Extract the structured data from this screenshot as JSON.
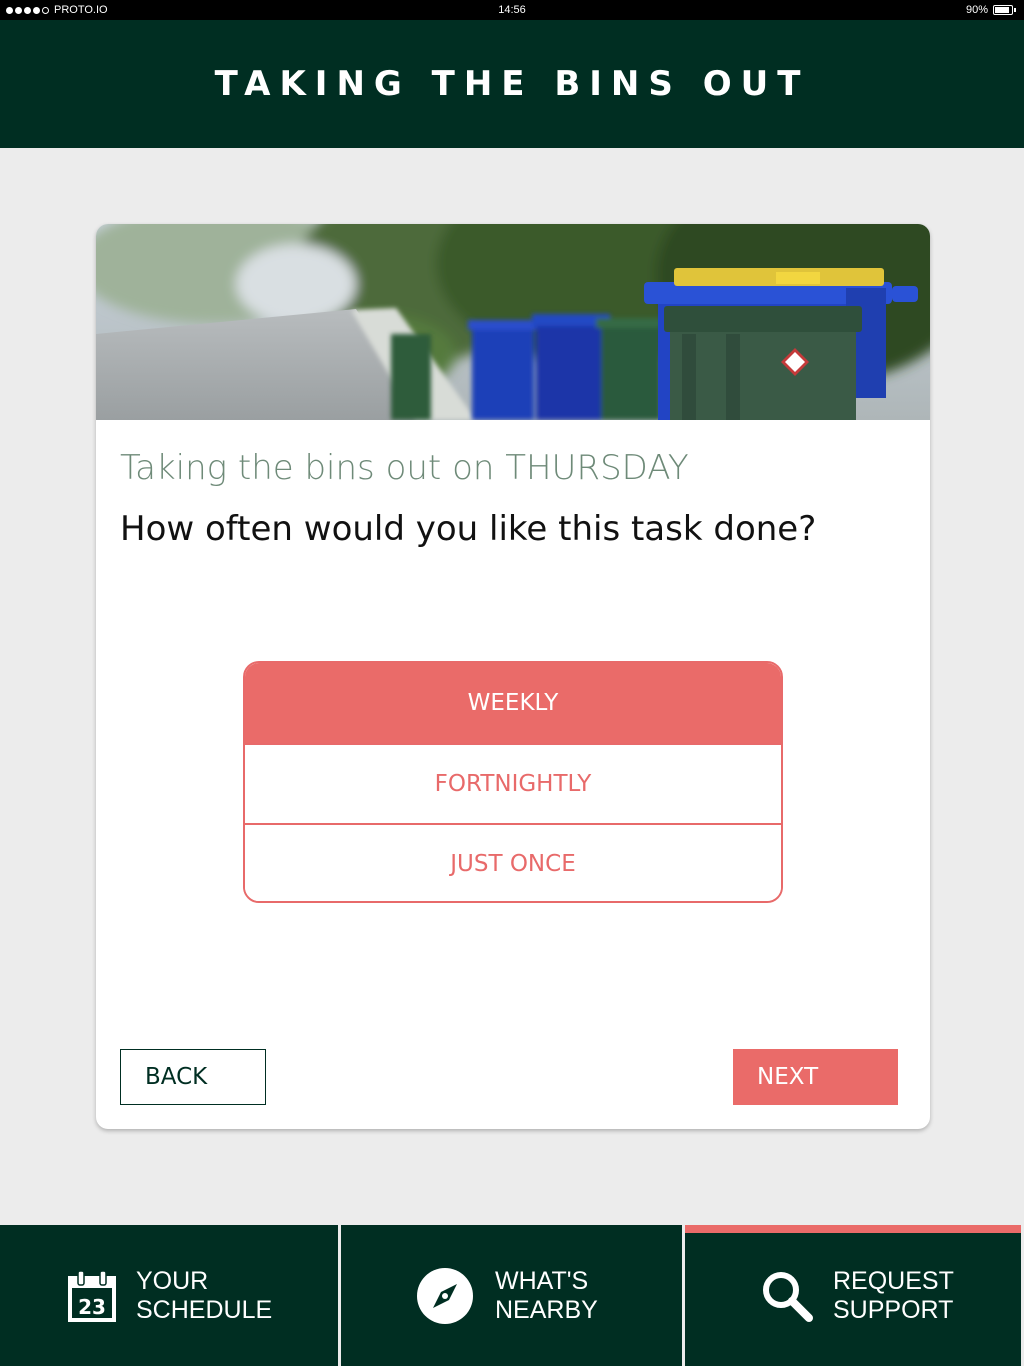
{
  "status_bar": {
    "carrier": "PROTO.IO",
    "time": "14:56",
    "battery": "90%",
    "battery_level": 0.9,
    "signal_bars": 4
  },
  "header": {
    "title": "TAKING THE BINS OUT"
  },
  "card": {
    "task_line": "Taking the bins out on THURSDAY",
    "question": "How often would you like this task done?",
    "options": [
      {
        "label": "WEEKLY",
        "selected": true
      },
      {
        "label": "FORTNIGHTLY",
        "selected": false
      },
      {
        "label": "JUST ONCE",
        "selected": false
      }
    ],
    "back_label": "BACK",
    "next_label": "NEXT"
  },
  "tabs": [
    {
      "line1": "YOUR",
      "line2": "SCHEDULE",
      "icon": "calendar-icon",
      "icon_text": "23",
      "active": false
    },
    {
      "line1": "WHAT'S",
      "line2": "NEARBY",
      "icon": "compass-icon",
      "active": false
    },
    {
      "line1": "REQUEST",
      "line2": "SUPPORT",
      "icon": "search-icon",
      "active": true
    }
  ],
  "colors": {
    "primary": "#002e22",
    "accent": "#ea6b69",
    "background": "#ececec",
    "muted_text": "#6e8a78"
  }
}
